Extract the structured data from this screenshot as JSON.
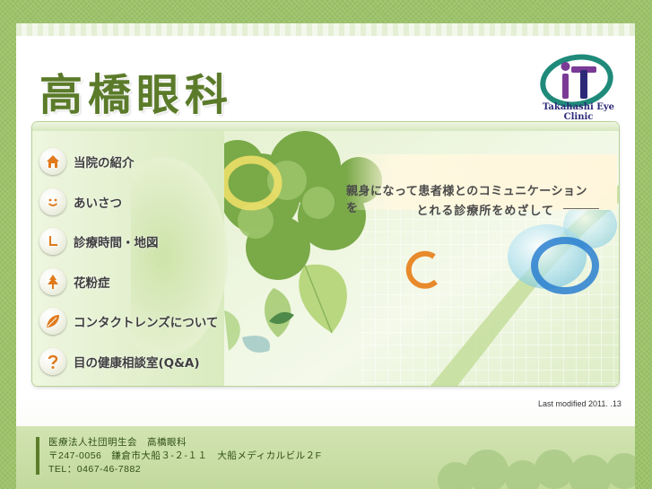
{
  "header": {
    "clinic_name": "高橋眼科",
    "clinic_name_en": "Takahashi Eye Clinic"
  },
  "nav": {
    "items": [
      {
        "label": "当院の紹介",
        "icon": "house-icon"
      },
      {
        "label": "あいさつ",
        "icon": "smile-icon"
      },
      {
        "label": "診療時間・地図",
        "icon": "clock-icon"
      },
      {
        "label": "花粉症",
        "icon": "tree-icon"
      },
      {
        "label": "コンタクトレンズについて",
        "icon": "leaf-icon"
      },
      {
        "label": "目の健康相談室(Q&A)",
        "icon": "question-icon"
      }
    ]
  },
  "tagline": {
    "line1": "親身になって患者様とのコミュニケーションを",
    "line2": "とれる診療所をめざして"
  },
  "last_modified": "Last modified 2011. .13",
  "footer": {
    "line1": "医療法人社団明生会　高橋眼科",
    "line2": "〒247-0056　鎌倉市大船３-２-１１　大船メディカルビル２F",
    "line3": "TEL：0467-46-7882"
  },
  "colors": {
    "brand_green": "#5b7b2a",
    "mark_navy": "#2c2a78",
    "mark_purple": "#7a3a96",
    "mark_teal": "#1f8a7a",
    "icon_orange": "#e07a1c"
  }
}
